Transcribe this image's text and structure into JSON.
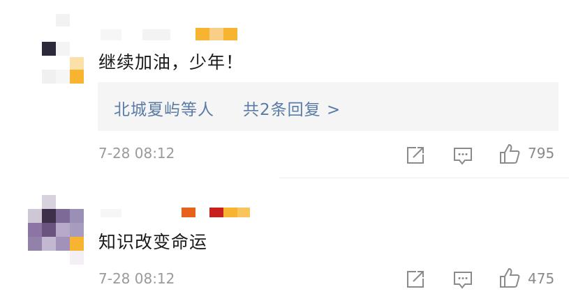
{
  "comments": [
    {
      "text": "继续加油，少年！",
      "replies": {
        "names": "北城夏屿等人",
        "count_label": "共2条回复 >"
      },
      "time": "7-28 08:12",
      "likes": "795",
      "icons": [
        "share-icon",
        "comment-icon",
        "like-icon"
      ]
    },
    {
      "text": "知识改变命运",
      "time": "7-28 08:12",
      "likes": "475",
      "icons": [
        "share-icon",
        "comment-icon",
        "like-icon"
      ]
    }
  ],
  "colors": {
    "link": "#5a7ba6",
    "meta": "#9a9a9a",
    "badge": "#f7b431"
  }
}
